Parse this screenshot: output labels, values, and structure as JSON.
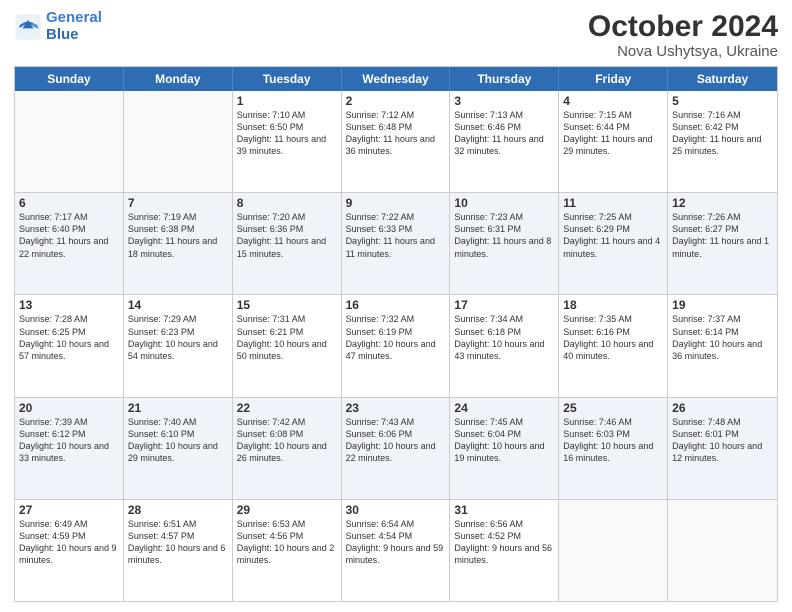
{
  "logo": {
    "line1": "General",
    "line2": "Blue"
  },
  "title": "October 2024",
  "location": "Nova Ushytsya, Ukraine",
  "days": [
    "Sunday",
    "Monday",
    "Tuesday",
    "Wednesday",
    "Thursday",
    "Friday",
    "Saturday"
  ],
  "weeks": [
    [
      {
        "num": "",
        "info": ""
      },
      {
        "num": "",
        "info": ""
      },
      {
        "num": "1",
        "info": "Sunrise: 7:10 AM\nSunset: 6:50 PM\nDaylight: 11 hours and 39 minutes."
      },
      {
        "num": "2",
        "info": "Sunrise: 7:12 AM\nSunset: 6:48 PM\nDaylight: 11 hours and 36 minutes."
      },
      {
        "num": "3",
        "info": "Sunrise: 7:13 AM\nSunset: 6:46 PM\nDaylight: 11 hours and 32 minutes."
      },
      {
        "num": "4",
        "info": "Sunrise: 7:15 AM\nSunset: 6:44 PM\nDaylight: 11 hours and 29 minutes."
      },
      {
        "num": "5",
        "info": "Sunrise: 7:16 AM\nSunset: 6:42 PM\nDaylight: 11 hours and 25 minutes."
      }
    ],
    [
      {
        "num": "6",
        "info": "Sunrise: 7:17 AM\nSunset: 6:40 PM\nDaylight: 11 hours and 22 minutes."
      },
      {
        "num": "7",
        "info": "Sunrise: 7:19 AM\nSunset: 6:38 PM\nDaylight: 11 hours and 18 minutes."
      },
      {
        "num": "8",
        "info": "Sunrise: 7:20 AM\nSunset: 6:36 PM\nDaylight: 11 hours and 15 minutes."
      },
      {
        "num": "9",
        "info": "Sunrise: 7:22 AM\nSunset: 6:33 PM\nDaylight: 11 hours and 11 minutes."
      },
      {
        "num": "10",
        "info": "Sunrise: 7:23 AM\nSunset: 6:31 PM\nDaylight: 11 hours and 8 minutes."
      },
      {
        "num": "11",
        "info": "Sunrise: 7:25 AM\nSunset: 6:29 PM\nDaylight: 11 hours and 4 minutes."
      },
      {
        "num": "12",
        "info": "Sunrise: 7:26 AM\nSunset: 6:27 PM\nDaylight: 11 hours and 1 minute."
      }
    ],
    [
      {
        "num": "13",
        "info": "Sunrise: 7:28 AM\nSunset: 6:25 PM\nDaylight: 10 hours and 57 minutes."
      },
      {
        "num": "14",
        "info": "Sunrise: 7:29 AM\nSunset: 6:23 PM\nDaylight: 10 hours and 54 minutes."
      },
      {
        "num": "15",
        "info": "Sunrise: 7:31 AM\nSunset: 6:21 PM\nDaylight: 10 hours and 50 minutes."
      },
      {
        "num": "16",
        "info": "Sunrise: 7:32 AM\nSunset: 6:19 PM\nDaylight: 10 hours and 47 minutes."
      },
      {
        "num": "17",
        "info": "Sunrise: 7:34 AM\nSunset: 6:18 PM\nDaylight: 10 hours and 43 minutes."
      },
      {
        "num": "18",
        "info": "Sunrise: 7:35 AM\nSunset: 6:16 PM\nDaylight: 10 hours and 40 minutes."
      },
      {
        "num": "19",
        "info": "Sunrise: 7:37 AM\nSunset: 6:14 PM\nDaylight: 10 hours and 36 minutes."
      }
    ],
    [
      {
        "num": "20",
        "info": "Sunrise: 7:39 AM\nSunset: 6:12 PM\nDaylight: 10 hours and 33 minutes."
      },
      {
        "num": "21",
        "info": "Sunrise: 7:40 AM\nSunset: 6:10 PM\nDaylight: 10 hours and 29 minutes."
      },
      {
        "num": "22",
        "info": "Sunrise: 7:42 AM\nSunset: 6:08 PM\nDaylight: 10 hours and 26 minutes."
      },
      {
        "num": "23",
        "info": "Sunrise: 7:43 AM\nSunset: 6:06 PM\nDaylight: 10 hours and 22 minutes."
      },
      {
        "num": "24",
        "info": "Sunrise: 7:45 AM\nSunset: 6:04 PM\nDaylight: 10 hours and 19 minutes."
      },
      {
        "num": "25",
        "info": "Sunrise: 7:46 AM\nSunset: 6:03 PM\nDaylight: 10 hours and 16 minutes."
      },
      {
        "num": "26",
        "info": "Sunrise: 7:48 AM\nSunset: 6:01 PM\nDaylight: 10 hours and 12 minutes."
      }
    ],
    [
      {
        "num": "27",
        "info": "Sunrise: 6:49 AM\nSunset: 4:59 PM\nDaylight: 10 hours and 9 minutes."
      },
      {
        "num": "28",
        "info": "Sunrise: 6:51 AM\nSunset: 4:57 PM\nDaylight: 10 hours and 6 minutes."
      },
      {
        "num": "29",
        "info": "Sunrise: 6:53 AM\nSunset: 4:56 PM\nDaylight: 10 hours and 2 minutes."
      },
      {
        "num": "30",
        "info": "Sunrise: 6:54 AM\nSunset: 4:54 PM\nDaylight: 9 hours and 59 minutes."
      },
      {
        "num": "31",
        "info": "Sunrise: 6:56 AM\nSunset: 4:52 PM\nDaylight: 9 hours and 56 minutes."
      },
      {
        "num": "",
        "info": ""
      },
      {
        "num": "",
        "info": ""
      }
    ]
  ]
}
